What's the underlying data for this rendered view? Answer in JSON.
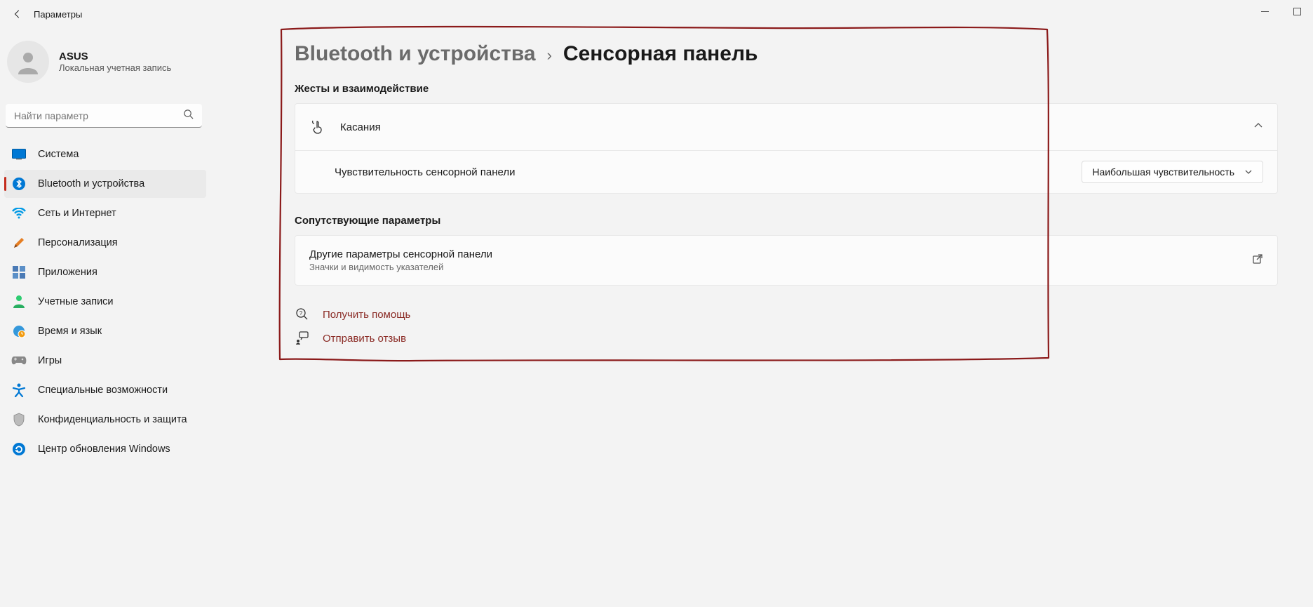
{
  "titlebar": {
    "title": "Параметры"
  },
  "profile": {
    "name": "ASUS",
    "sub": "Локальная учетная запись"
  },
  "search": {
    "placeholder": "Найти параметр"
  },
  "sidebar": {
    "items": [
      {
        "label": "Система"
      },
      {
        "label": "Bluetooth и устройства"
      },
      {
        "label": "Сеть и Интернет"
      },
      {
        "label": "Персонализация"
      },
      {
        "label": "Приложения"
      },
      {
        "label": "Учетные записи"
      },
      {
        "label": "Время и язык"
      },
      {
        "label": "Игры"
      },
      {
        "label": "Специальные возможности"
      },
      {
        "label": "Конфиденциальность и защита"
      },
      {
        "label": "Центр обновления Windows"
      }
    ]
  },
  "breadcrumb": {
    "parent": "Bluetooth и устройства",
    "current": "Сенсорная панель"
  },
  "sections": {
    "gestures": "Жесты и взаимодействие",
    "related": "Сопутствующие параметры"
  },
  "touch": {
    "title": "Касания",
    "sensitivity_label": "Чувствительность сенсорной панели",
    "sensitivity_value": "Наибольшая чувствительность"
  },
  "other": {
    "title": "Другие параметры сенсорной панели",
    "desc": "Значки и видимость указателей"
  },
  "help": {
    "get_help": "Получить помощь",
    "feedback": "Отправить отзыв"
  }
}
